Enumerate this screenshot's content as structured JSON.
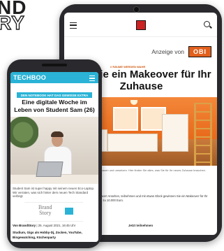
{
  "brand": {
    "line1": "ND",
    "line2": "RY"
  },
  "tablet": {
    "ad_label": "Anzeige von",
    "ad_logo": "OBI",
    "kicker": "// RÄUME WERDEN WAHR",
    "headline": "nen Sie ein Makeover für Ihr Zuhause",
    "caption": "Mit OBI Projekte planen, bauen und umsetzen. Hier finden Sie alles, was Sie für Ihr neues Zuhause brauchen.",
    "body": "Gewinnen Sie ein Makeover! Ansehen, teilnehmen und mit etwas Glück gewinnen Sie ein Makeover für Ihr Zuhause im Wert von bis zu 10.000 Euro.",
    "cta": "Jetzt teilnehmen"
  },
  "phone": {
    "logo": "TECHBOO",
    "kicker": "DEN NOTEBOOK HAT DAS GEWISSE EXTRA",
    "headline": "Eine digitale Woche im Leben von Student Sam (26)",
    "caption": "Student Sam ist super happy mit seinem neuen Eco-Laptop. Wir verraten, was sich hinter dem neuen Tech Standard verbirgt",
    "brand_title_1": "Brand",
    "brand_title_2": "Story",
    "byline_author": "Von BrandStory",
    "byline_date": "| 25. August 2021, 16:45 Uhr",
    "tags": "Studium, Gigs als Hobby-Dj, Zocken, YouTube, Bingewatching, Küchenparty"
  }
}
